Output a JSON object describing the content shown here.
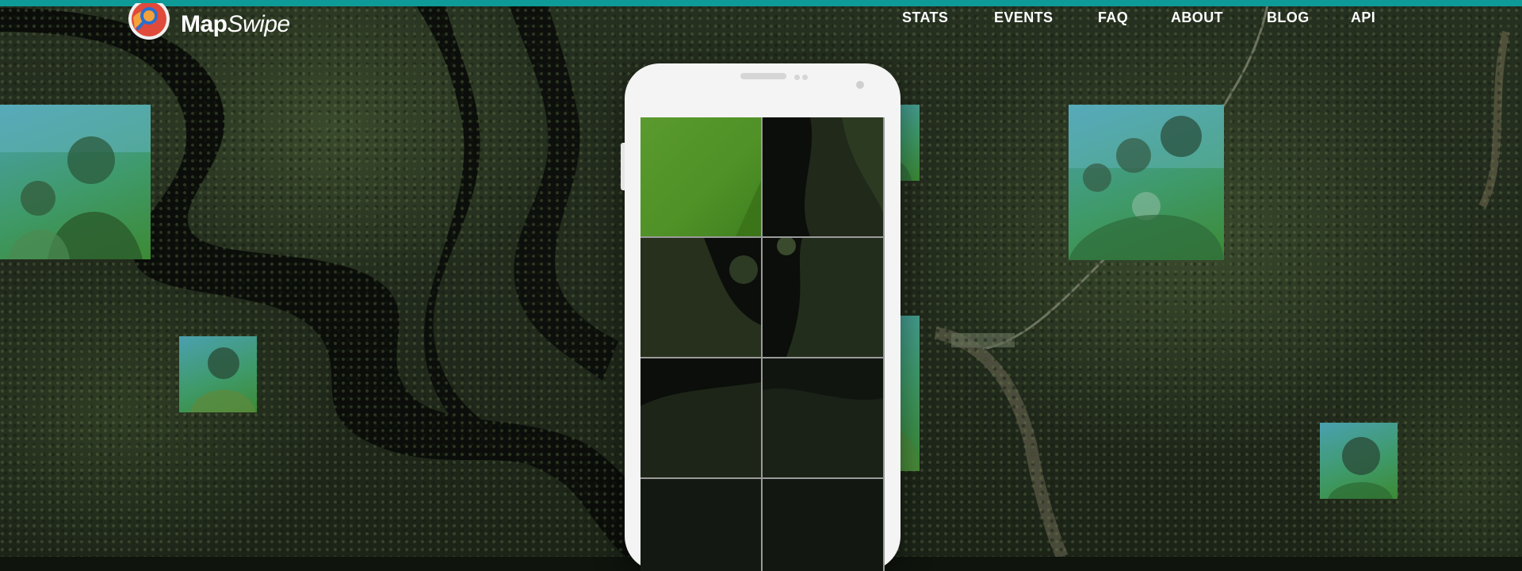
{
  "header": {
    "logo": {
      "bold": "Map",
      "italic": "Swipe"
    },
    "nav": [
      {
        "label": "STATS"
      },
      {
        "label": "EVENTS"
      },
      {
        "label": "FAQ"
      },
      {
        "label": "ABOUT"
      },
      {
        "label": "BLOG"
      },
      {
        "label": "API"
      }
    ]
  },
  "colors": {
    "accent": "#0e9a97",
    "selected_tile": "#4f9126",
    "photo_tint_start": "#4aa0b0",
    "photo_tint_end": "#3c8a34"
  },
  "icons": {
    "logo": "magnifier-pin-icon"
  },
  "phone": {
    "tiles": [
      "selected",
      "plain",
      "plain",
      "plain",
      "plain",
      "plain",
      "plain",
      "plain"
    ]
  }
}
